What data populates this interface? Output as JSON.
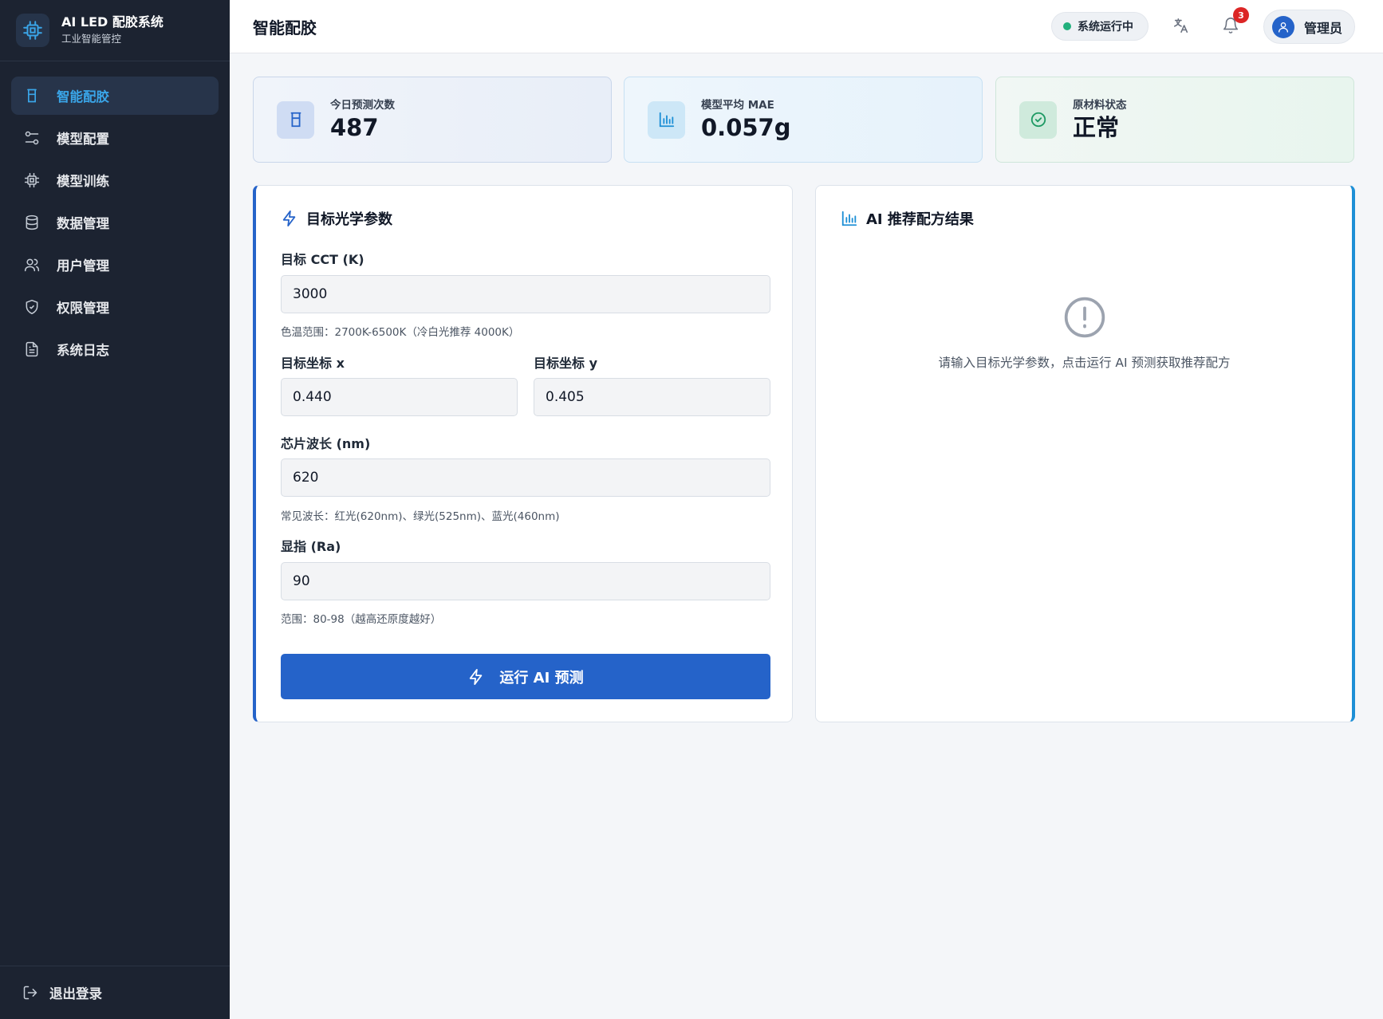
{
  "brand": {
    "title": "AI LED 配胶系统",
    "subtitle": "工业智能管控",
    "logo_icon": "cpu-icon"
  },
  "sidebar": {
    "items": [
      {
        "label": "智能配胶",
        "icon": "beaker-icon",
        "active": true
      },
      {
        "label": "模型配置",
        "icon": "sliders-icon",
        "active": false
      },
      {
        "label": "模型训练",
        "icon": "cpu-icon",
        "active": false
      },
      {
        "label": "数据管理",
        "icon": "database-icon",
        "active": false
      },
      {
        "label": "用户管理",
        "icon": "users-icon",
        "active": false
      },
      {
        "label": "权限管理",
        "icon": "shield-icon",
        "active": false
      },
      {
        "label": "系统日志",
        "icon": "file-text-icon",
        "active": false
      }
    ],
    "logout_label": "退出登录"
  },
  "header": {
    "title": "智能配胶",
    "status_text": "系统运行中",
    "notification_count": "3",
    "user_name": "管理员"
  },
  "stats": [
    {
      "label": "今日预测次数",
      "value": "487",
      "icon": "beaker-icon"
    },
    {
      "label": "模型平均 MAE",
      "value": "0.057g",
      "icon": "bar-chart-icon"
    },
    {
      "label": "原材料状态",
      "value": "正常",
      "icon": "check-circle-icon"
    }
  ],
  "form": {
    "title": "目标光学参数",
    "cct": {
      "label": "目标 CCT (K)",
      "value": "3000",
      "hint": "色温范围：2700K-6500K（冷白光推荐 4000K）"
    },
    "x": {
      "label": "目标坐标 x",
      "value": "0.440"
    },
    "y": {
      "label": "目标坐标 y",
      "value": "0.405"
    },
    "wavelength": {
      "label": "芯片波长 (nm)",
      "value": "620",
      "hint": "常见波长：红光(620nm)、绿光(525nm)、蓝光(460nm)"
    },
    "ra": {
      "label": "显指 (Ra)",
      "value": "90",
      "hint": "范围：80-98（越高还原度越好）"
    },
    "submit_label": "运行 AI 预测"
  },
  "result": {
    "title": "AI 推荐配方结果",
    "empty_message": "请输入目标光学参数，点击运行 AI 预测获取推荐配方"
  },
  "colors": {
    "primary": "#2563c9",
    "accent": "#1d8fd6",
    "sidebar_bg": "#1c2331",
    "success": "#22b07d",
    "danger": "#dc2626"
  }
}
